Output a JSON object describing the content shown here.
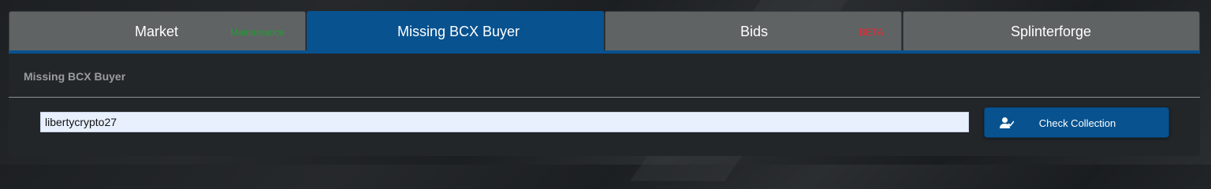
{
  "tabs": [
    {
      "label": "Market",
      "badge": "Maintenance",
      "badge_color": "#1e9e2f"
    },
    {
      "label": "Missing BCX Buyer",
      "badge": "",
      "active": true
    },
    {
      "label": "Bids",
      "badge": "BETA",
      "badge_color": "#e8262f"
    },
    {
      "label": "Splinterforge",
      "badge": ""
    }
  ],
  "section": {
    "title": "Missing BCX Buyer"
  },
  "form": {
    "username_value": "libertycrypto27",
    "check_button_label": "Check Collection",
    "check_button_icon": "user-check-icon"
  },
  "colors": {
    "accent": "#08528f",
    "tab_inactive": "#5f6364",
    "panel": "#222629"
  }
}
